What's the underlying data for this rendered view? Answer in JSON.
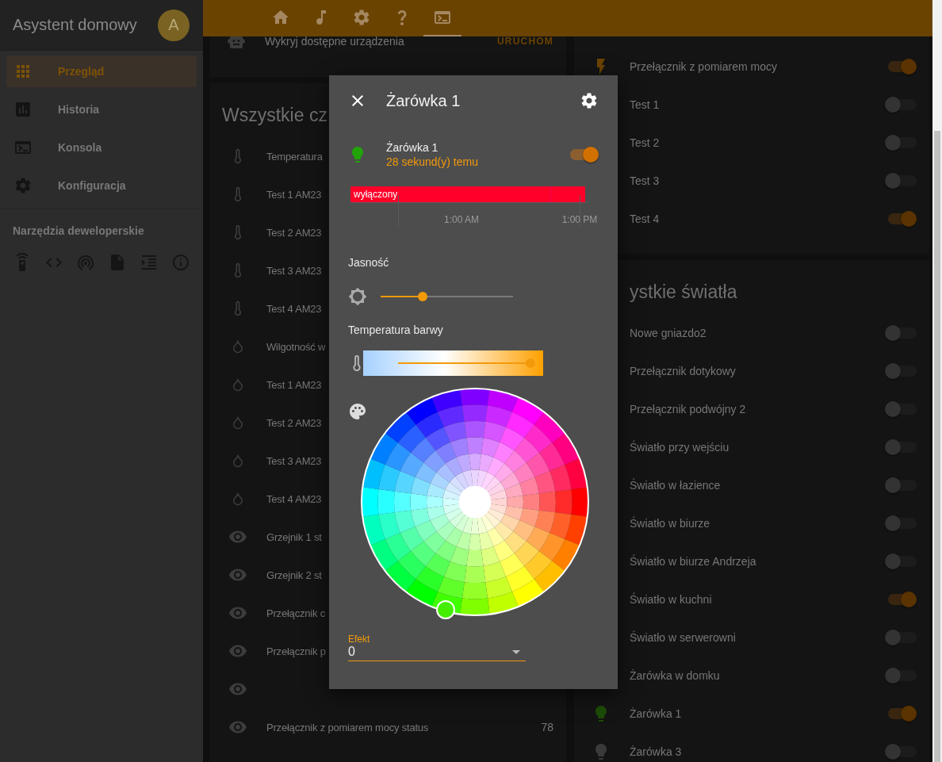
{
  "sidebar": {
    "title": "Asystent domowy",
    "avatar": "A",
    "items": [
      {
        "kind": "overview",
        "label": "Przegląd",
        "selected": true
      },
      {
        "kind": "history",
        "label": "Historia",
        "selected": false
      },
      {
        "kind": "console",
        "label": "Konsola",
        "selected": false
      },
      {
        "kind": "config",
        "label": "Konfiguracja",
        "selected": false
      }
    ],
    "dev_tools_title": "Narzędzia deweloperskie",
    "dev_tools": [
      {
        "kind": "remote"
      },
      {
        "kind": "code"
      },
      {
        "kind": "antenna"
      },
      {
        "kind": "file"
      },
      {
        "kind": "indent"
      },
      {
        "kind": "info"
      }
    ]
  },
  "toolbar": {
    "tabs": [
      {
        "kind": "home",
        "selected": false
      },
      {
        "kind": "music",
        "selected": false
      },
      {
        "kind": "settings",
        "selected": false
      },
      {
        "kind": "help",
        "selected": false
      },
      {
        "kind": "console",
        "selected": true
      }
    ]
  },
  "discovery_card": {
    "text": "Wykryj dostępne urządzenia",
    "button": "URUCHOM"
  },
  "sensors_card": {
    "title": "Wszystkie cz",
    "rows": [
      {
        "kind": "temperature",
        "name": "Temperatura"
      },
      {
        "kind": "temperature",
        "name": "Test 1 AM23"
      },
      {
        "kind": "temperature",
        "name": "Test 2 AM23"
      },
      {
        "kind": "temperature",
        "name": "Test 3 AM23"
      },
      {
        "kind": "temperature",
        "name": "Test 4 AM23"
      },
      {
        "kind": "humidity",
        "name": "Wilgotność w"
      },
      {
        "kind": "humidity",
        "name": "Test 1 AM23"
      },
      {
        "kind": "humidity",
        "name": "Test 2 AM23"
      },
      {
        "kind": "humidity",
        "name": "Test 3 AM23"
      },
      {
        "kind": "humidity",
        "name": "Test 4 AM23"
      },
      {
        "kind": "status",
        "name": "Grzejnik 1 st"
      },
      {
        "kind": "status",
        "name": "Grzejnik 2 st"
      },
      {
        "kind": "status",
        "name": "Przełącznik c"
      },
      {
        "kind": "status",
        "name": "Przełącznik p"
      },
      {
        "kind": "status"
      },
      {
        "kind": "status",
        "name": "Przełącznik z pomiarem mocy status",
        "value": "78"
      }
    ]
  },
  "switches_card": {
    "rows": [
      {
        "kind": "power",
        "name": "Przełącznik z pomiarem mocy",
        "on": true
      },
      {
        "kind": "plain",
        "name": "Test 1",
        "on": false
      },
      {
        "kind": "plain",
        "name": "Test 2",
        "on": false
      },
      {
        "kind": "plain",
        "name": "Test 3",
        "on": false
      },
      {
        "kind": "plain",
        "name": "Test 4",
        "on": true
      }
    ]
  },
  "lights_card": {
    "title": "ystkie światła",
    "rows": [
      {
        "kind": "plain",
        "name": "Nowe gniazdo2",
        "on": false
      },
      {
        "kind": "plain",
        "name": "Przełącznik dotykowy",
        "on": false
      },
      {
        "kind": "plain",
        "name": "Przełącznik podwójny 2",
        "on": false
      },
      {
        "kind": "plain",
        "name": "Światło przy wejściu",
        "on": false
      },
      {
        "kind": "plain",
        "name": "Światło w łazience",
        "on": false
      },
      {
        "kind": "plain",
        "name": "Światło w biurze",
        "on": false
      },
      {
        "kind": "plain",
        "name": "Światło w biurze Andrzeja",
        "on": false
      },
      {
        "kind": "plain",
        "name": "Światło w kuchni",
        "on": true
      },
      {
        "kind": "plain",
        "name": "Światło w serwerowni",
        "on": false
      },
      {
        "kind": "plain",
        "name": "Żarówka w domku",
        "on": false
      },
      {
        "kind": "bulb",
        "name": "Żarówka 1",
        "on": true
      },
      {
        "kind": "bulb",
        "name": "Żarówka 3",
        "on": false
      }
    ]
  },
  "dialog": {
    "title": "Żarówka 1",
    "entity": {
      "name": "Żarówka 1",
      "last_changed": "28 sekund(y) temu",
      "on": true
    },
    "history": {
      "state": "wyłączony",
      "ticks": [
        "1:00 AM",
        "1:00 PM"
      ]
    },
    "brightness": {
      "label": "Jasność",
      "level": 0.32
    },
    "color_temp": {
      "label": "Temperatura barwy",
      "level": 1.0
    },
    "effect": {
      "label": "Efekt",
      "value": "0"
    }
  }
}
